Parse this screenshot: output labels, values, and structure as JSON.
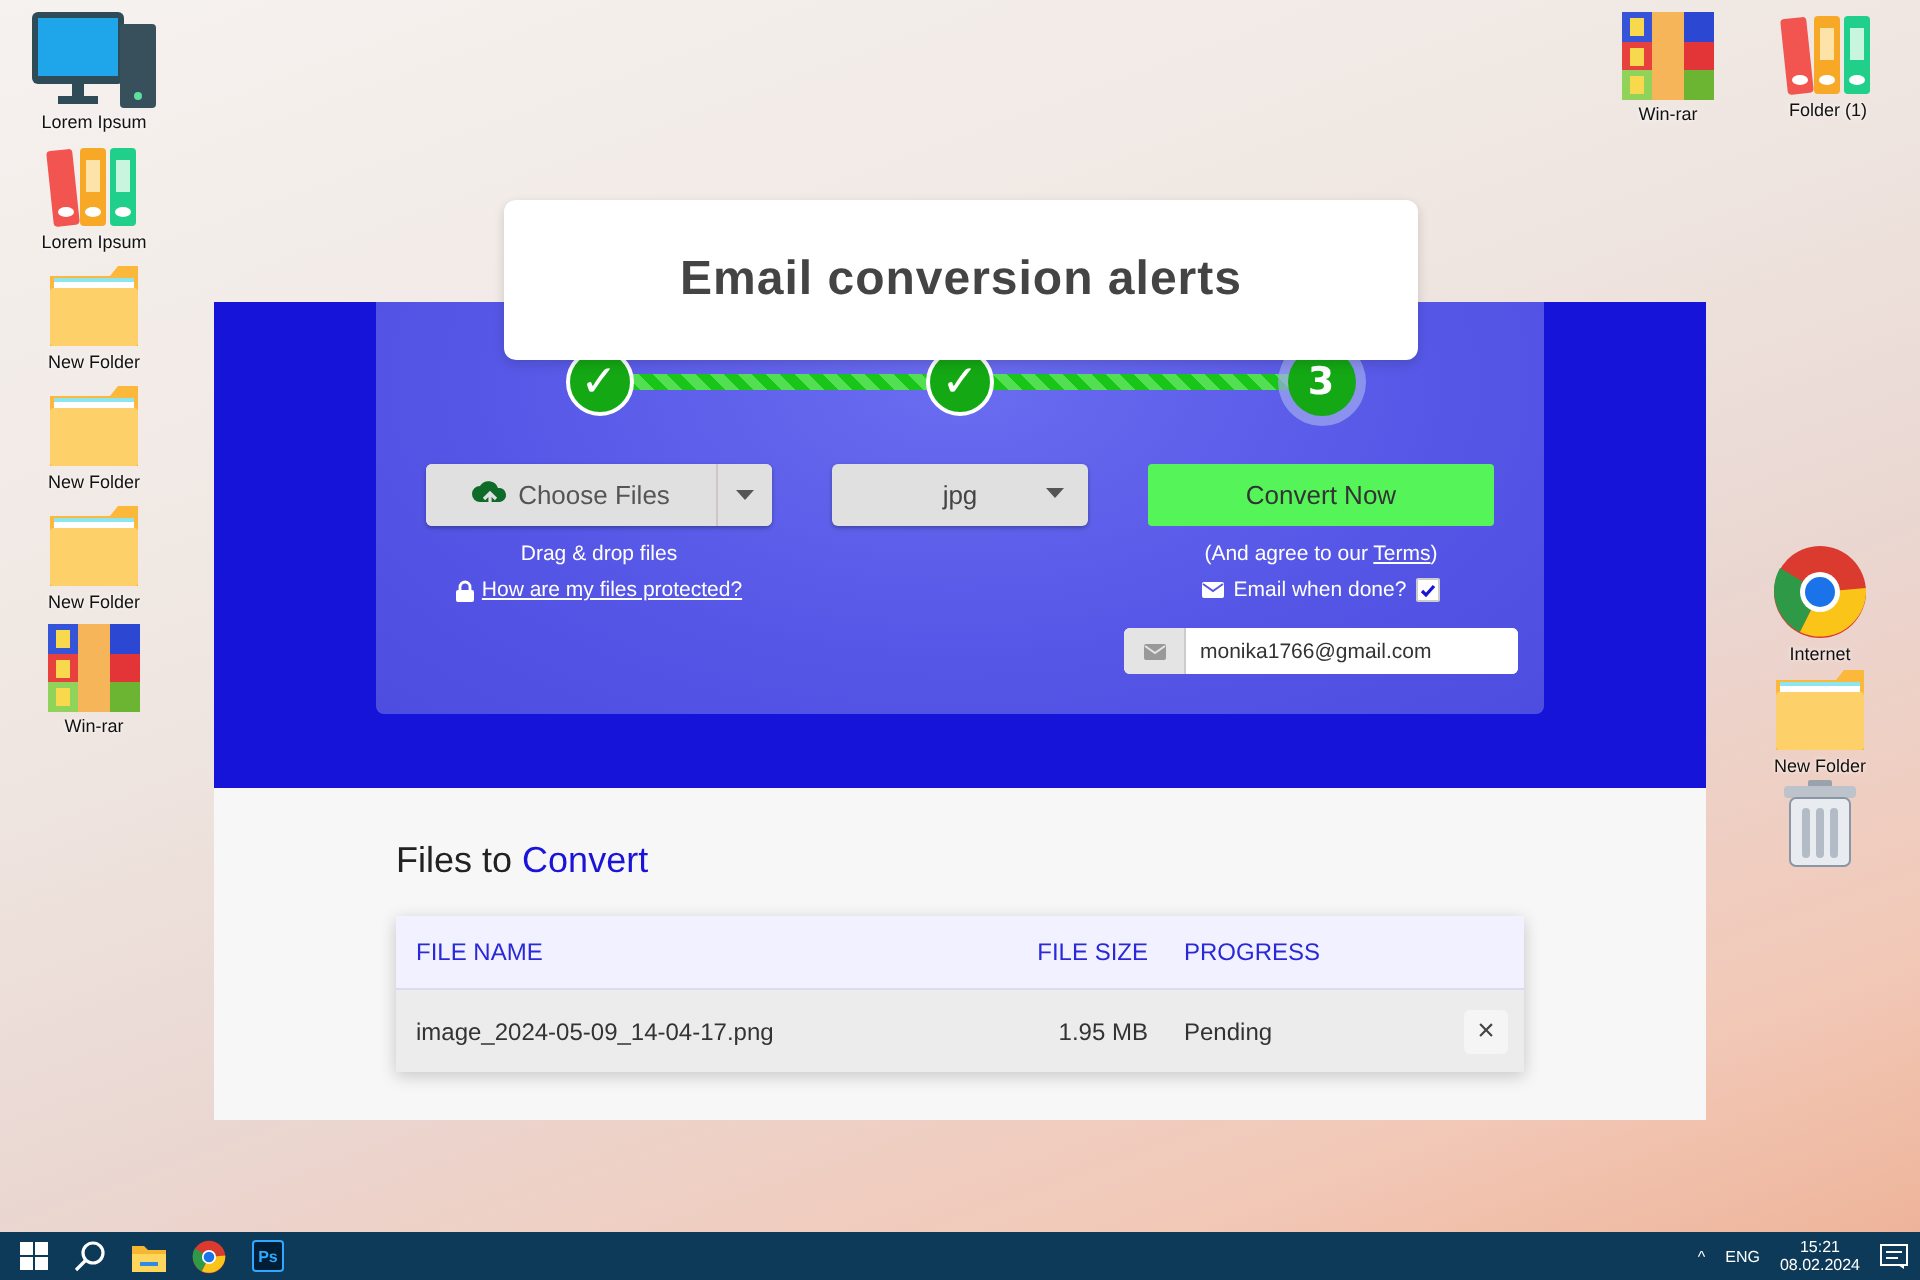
{
  "desktop": {
    "left_icons": [
      {
        "kind": "computer",
        "label": "Lorem Ipsum"
      },
      {
        "kind": "binders",
        "label": "Lorem Ipsum"
      },
      {
        "kind": "folder",
        "label": "New Folder"
      },
      {
        "kind": "folder",
        "label": "New Folder"
      },
      {
        "kind": "folder",
        "label": "New Folder"
      },
      {
        "kind": "archive",
        "label": "Win-rar"
      }
    ],
    "top_right_icons": [
      {
        "kind": "archive",
        "label": "Win-rar"
      },
      {
        "kind": "binders",
        "label": "Folder (1)"
      }
    ],
    "right_icons": [
      {
        "kind": "browser",
        "label": "Internet"
      },
      {
        "kind": "folder",
        "label": "New Folder"
      },
      {
        "kind": "trash"
      }
    ]
  },
  "callout": {
    "title": "Email conversion alerts"
  },
  "steps": [
    {
      "label": "✓",
      "completed": true
    },
    {
      "label": "✓",
      "completed": true
    },
    {
      "label": "3",
      "completed": false
    }
  ],
  "converter": {
    "choose_files": "Choose Files",
    "drop_hint": "Drag & drop files",
    "protected_link": "How are my files protected?",
    "format": "jpg",
    "convert_button": "Convert Now",
    "agree": {
      "before": "(And agree to our ",
      "link": "Terms",
      "after": ")"
    },
    "email_option": {
      "label": "Email when done?",
      "checked": true
    },
    "email_field": {
      "value": "monika1766@gmail.com"
    }
  },
  "files": {
    "heading": "Files to",
    "heading_highlight": "Convert",
    "columns": [
      "FILE NAME",
      "FILE SIZE",
      "PROGRESS"
    ],
    "rows": [
      {
        "name": "image_2024-05-09_14-04-17.png",
        "size": "1.95 MB",
        "progress": "Pending",
        "remove": "×"
      }
    ]
  },
  "taskbar": {
    "apps": [
      {
        "kind": "start"
      },
      {
        "kind": "search"
      },
      {
        "kind": "explorer"
      },
      {
        "kind": "browser"
      },
      {
        "kind": "photoshop",
        "label": "Ps"
      }
    ],
    "tray": {
      "chevron": "^",
      "language": "ENG",
      "time": "15:21",
      "date": "08.02.2024"
    }
  }
}
